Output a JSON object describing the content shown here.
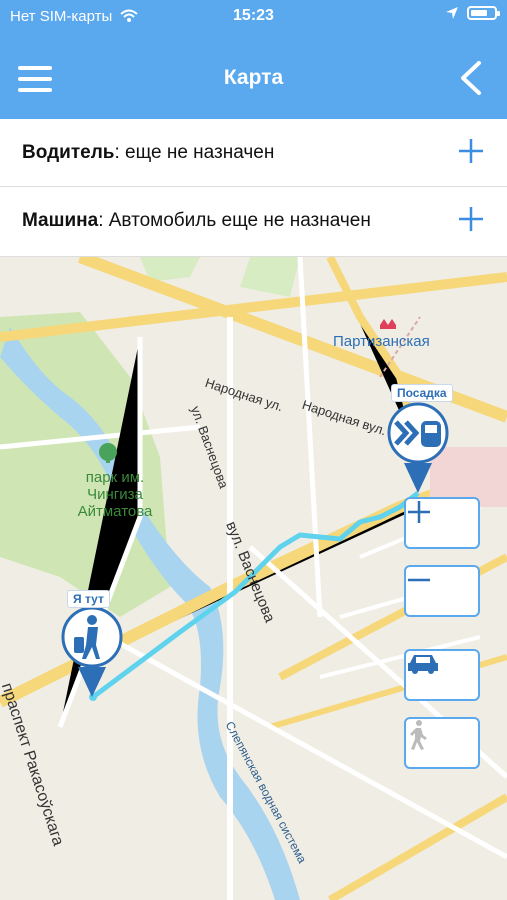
{
  "status": {
    "carrier": "Нет SIM-карты",
    "time": "15:23"
  },
  "header": {
    "title": "Карта"
  },
  "info": {
    "driver_label": "Водитель",
    "driver_value": ": еще не назначен",
    "car_label": "Машина",
    "car_value": ": Автомобиль еще не назначен"
  },
  "map": {
    "labels": {
      "station": "Партизанская",
      "street1": "Народная ул.",
      "street2": "Народная вул.",
      "street3": "ул. Васнецова",
      "street4": "вул. Васнецова",
      "park1": "парк им.",
      "park2": "Чингиза",
      "park3": "Айтматова",
      "avenue": "праспект Ракасоўскага",
      "river": "Слепянская водная система"
    },
    "markers": {
      "pickup": "Посадка",
      "me": "Я тут"
    }
  },
  "colors": {
    "accent": "#5aa9ee",
    "route": "#5fd3ee"
  }
}
